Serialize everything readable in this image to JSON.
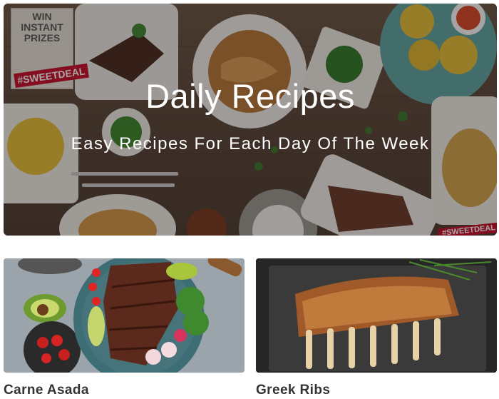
{
  "hero": {
    "title": "Daily Recipes",
    "subtitle": "Easy Recipes For Each Day Of The Week",
    "promo": {
      "line1": "WIN",
      "line2": "INSTANT",
      "line3": "PRIZES",
      "hashtag": "#SWEETDEAL"
    },
    "corner_tag": "#SWEETDEAL"
  },
  "cards": [
    {
      "title": "Carne Asada",
      "image": "carne-asada-photo"
    },
    {
      "title": "Greek Ribs",
      "image": "greek-ribs-photo"
    }
  ],
  "colors": {
    "wood": "#5c4a3d",
    "title_text": "#333333",
    "promo_red": "#c8102e"
  }
}
